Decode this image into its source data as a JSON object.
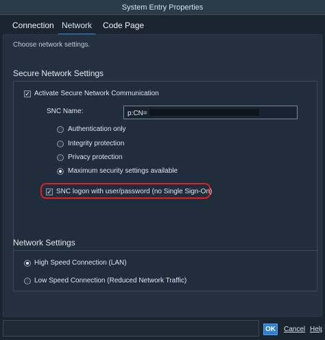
{
  "window": {
    "title": "System Entry Properties"
  },
  "tabs": [
    {
      "label": "Connection"
    },
    {
      "label": "Network"
    },
    {
      "label": "Code Page"
    }
  ],
  "intro": "Choose network settings.",
  "secure": {
    "title": "Secure Network Settings",
    "activate_label": "Activate Secure Network Communication",
    "activate_checked": true,
    "snc_name_label": "SNC Name:",
    "snc_name_value": "p:CN=",
    "options": [
      {
        "label": "Authentication only",
        "checked": false
      },
      {
        "label": "Integrity protection",
        "checked": false
      },
      {
        "label": "Privacy protection",
        "checked": false
      },
      {
        "label": "Maximum security settings available",
        "checked": true
      }
    ],
    "snc_logon_label": "SNC logon with user/password (no Single Sign-On)",
    "snc_logon_checked": true
  },
  "network": {
    "title": "Network Settings",
    "options": [
      {
        "label": "High Speed Connection (LAN)",
        "checked": true
      },
      {
        "label": "Low Speed Connection (Reduced Network Traffic)",
        "checked": false
      }
    ]
  },
  "footer": {
    "ok_label": "OK",
    "cancel_label": "Cancel",
    "help_label": "Help"
  },
  "colors": {
    "accent": "#2e7fd6",
    "highlight": "#e0202a"
  }
}
